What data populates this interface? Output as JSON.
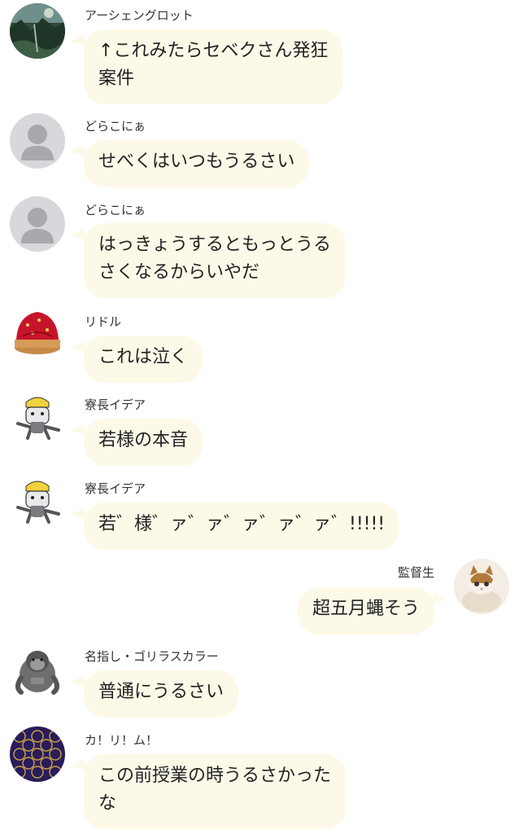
{
  "messages": [
    {
      "side": "left",
      "name": "アーシェングロット",
      "lines": [
        "↑これみたらセベクさん発狂",
        "案件"
      ],
      "avatar": "forest-avatar"
    },
    {
      "side": "left",
      "name": "どらこにぁ",
      "lines": [
        "せべくはいつもうるさい"
      ],
      "avatar": "default-user-avatar"
    },
    {
      "side": "left",
      "name": "どらこにぁ",
      "lines": [
        "はっきょうするともっとうる",
        "さくなるからいやだ"
      ],
      "avatar": "default-user-avatar"
    },
    {
      "side": "left",
      "name": "リドル",
      "lines": [
        "これは泣く"
      ],
      "avatar": "strawberry-tart-avatar"
    },
    {
      "side": "left",
      "name": "寮長イデア",
      "lines": [
        "若様の本音"
      ],
      "avatar": "cat-helmet-avatar"
    },
    {
      "side": "left",
      "name": "寮長イデア",
      "lines": [
        "若゛様゛ァ゛ァ゛ァ゛ァ゛ァ゛!!!!!"
      ],
      "avatar": "cat-helmet-avatar"
    },
    {
      "side": "right",
      "name": "監督生",
      "lines": [
        "超五月蝿そう"
      ],
      "avatar": "kitten-avatar"
    },
    {
      "side": "left",
      "name": "名指し・ゴリラスカラー",
      "lines": [
        "普通にうるさい"
      ],
      "avatar": "gorilla-avatar"
    },
    {
      "side": "left",
      "name": "カ！リ！ム！",
      "lines": [
        "この前授業の時うるさかった",
        "な"
      ],
      "avatar": "pattern-avatar"
    }
  ],
  "colors": {
    "bubble": "#fdf9e8",
    "name_text": "#333333",
    "text": "#222222"
  }
}
